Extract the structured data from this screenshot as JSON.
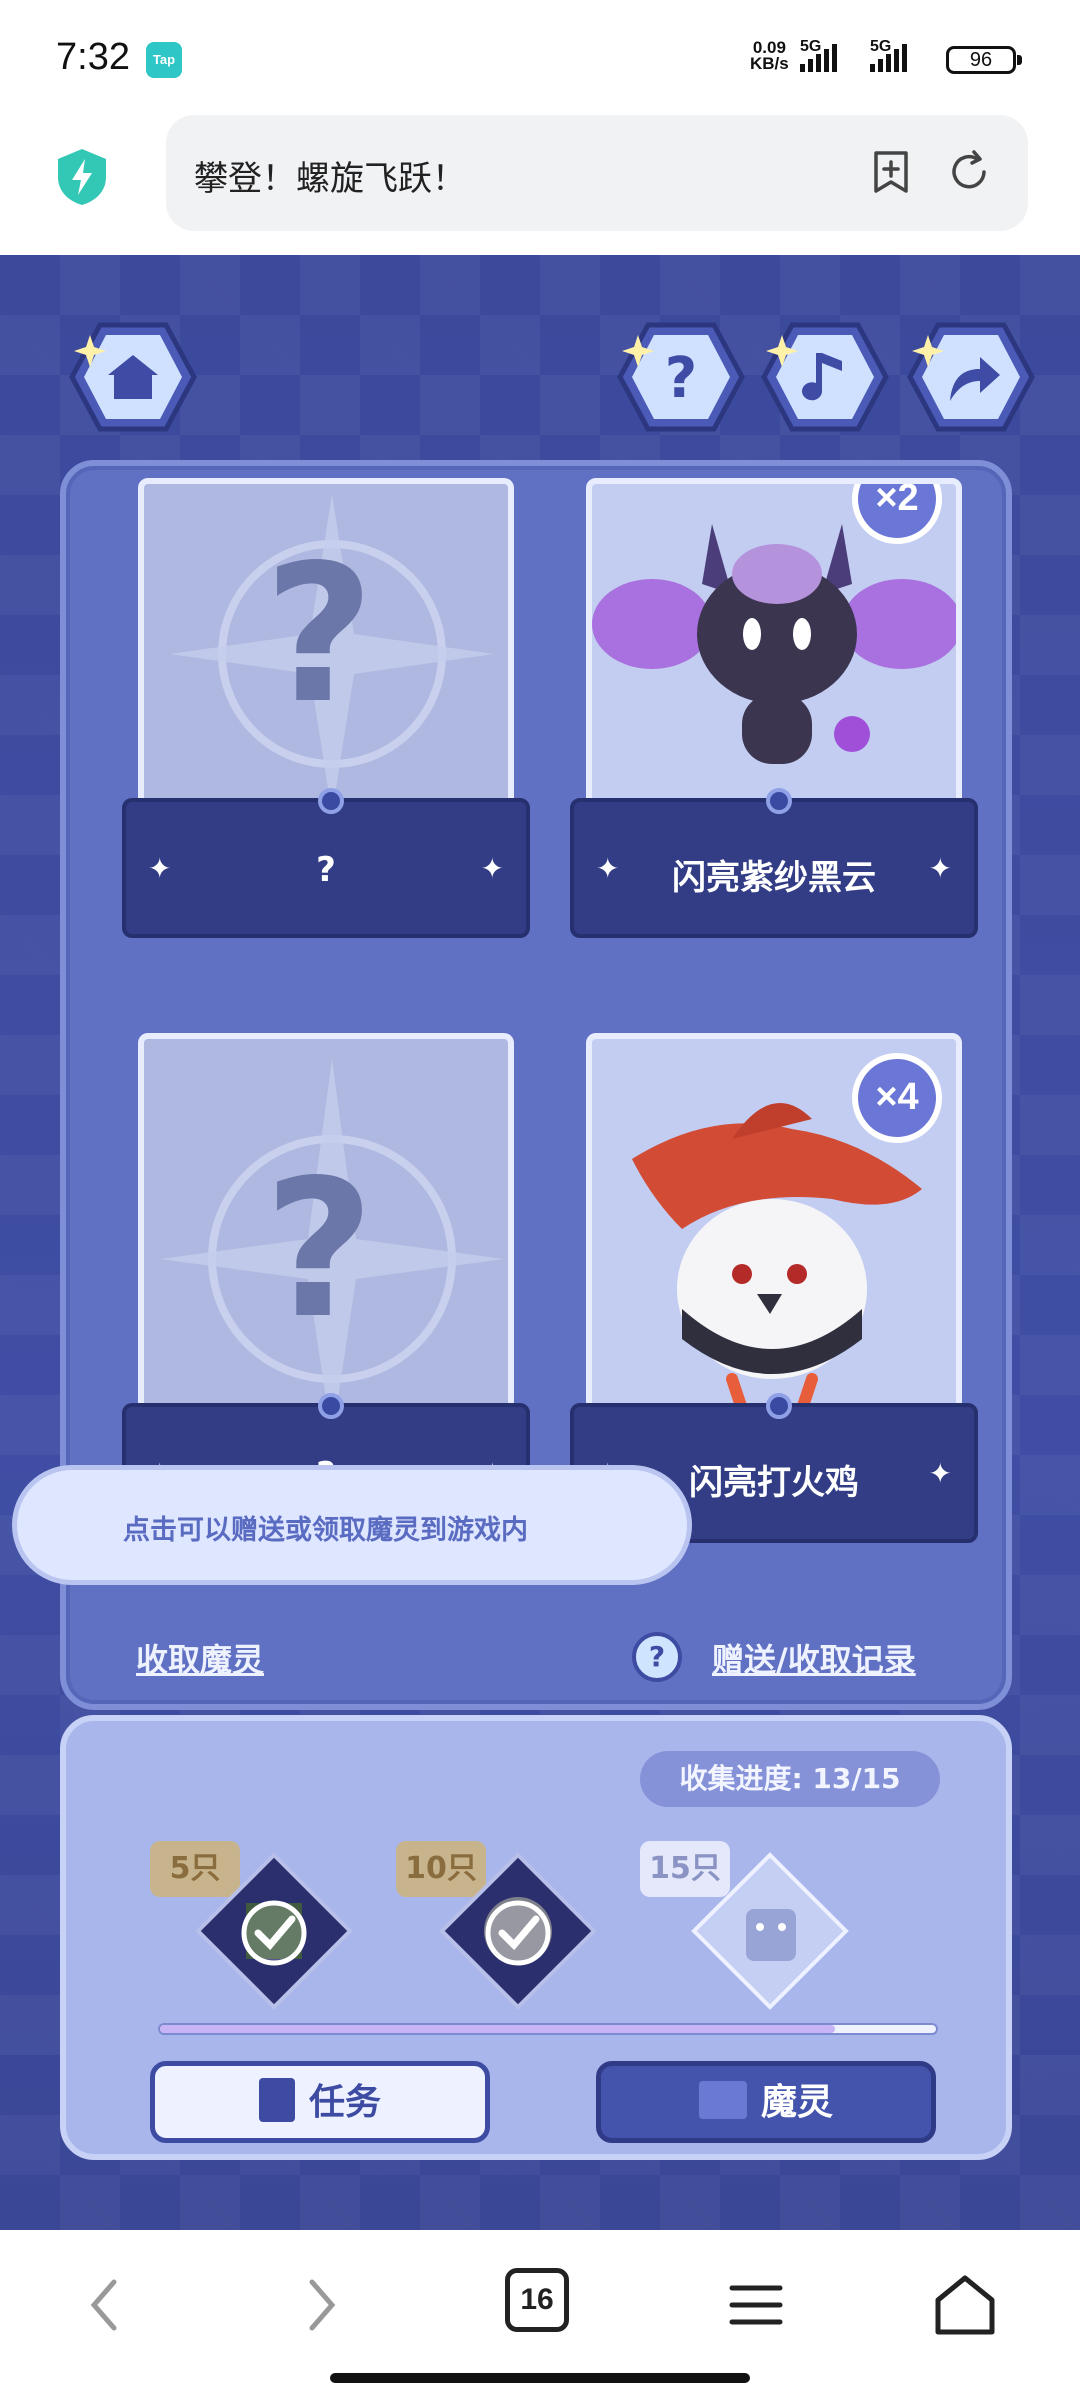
{
  "status_bar": {
    "time": "7:32",
    "app_badge": "Tap",
    "net_speed_top": "0.09",
    "net_speed_bottom": "KB/s",
    "signal1": "5G",
    "signal2": "5G",
    "battery": "96"
  },
  "browser": {
    "title": "攀登！螺旋飞跃！"
  },
  "game": {
    "cards": [
      {
        "name": "?",
        "state": "unknown"
      },
      {
        "name": "闪亮紫纱黑云",
        "count_badge": "×2",
        "state": "owned"
      },
      {
        "name": "?",
        "state": "unknown"
      },
      {
        "name": "闪亮打火鸡",
        "count_badge": "×4",
        "state": "owned"
      }
    ],
    "tooltip": "点击可以赠送或领取魔灵到游戏内",
    "links": {
      "collect": "收取魔灵",
      "history": "赠送/收取记录"
    },
    "progress": {
      "label": "收集进度: 13/15",
      "milestones": [
        {
          "label": "5只",
          "claimed": true
        },
        {
          "label": "10只",
          "claimed": true
        },
        {
          "label": "15只",
          "claimed": false
        }
      ],
      "fill_fraction": 0.87
    },
    "buttons": {
      "tasks": "任务",
      "spirits": "魔灵"
    }
  },
  "nav": {
    "tab_count": "16"
  },
  "colors": {
    "game_bg": "#3c4a9c",
    "accent": "#4453ac",
    "card_pocket": "#323d86"
  }
}
